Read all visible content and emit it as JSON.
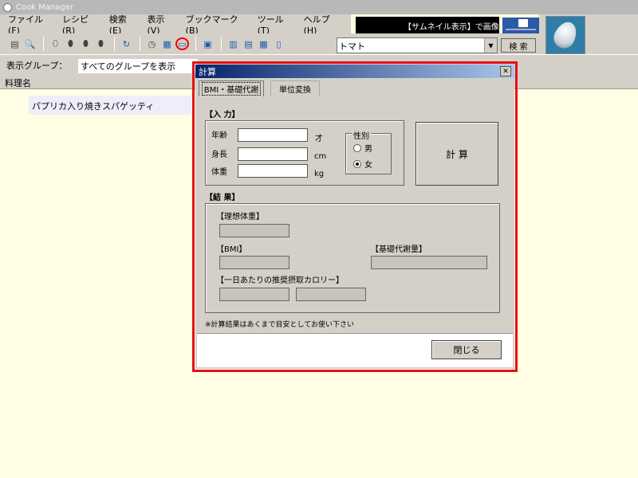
{
  "app": {
    "title": "Cook Manager"
  },
  "menu": [
    "ファイル(F)",
    "レシピ(R)",
    "検索(E)",
    "表示(V)",
    "ブックマーク(B)",
    "ツール(T)",
    "ヘルプ(H)"
  ],
  "caption_banner": "【サムネイル表示】で画像",
  "toolbar": {
    "search_value": "トマト",
    "search_button": "検 索"
  },
  "group_bar": {
    "label": "表示グループ：",
    "value": "すべてのグループを表示"
  },
  "list": {
    "header": "料理名",
    "rows": [
      "パプリカ入り焼きスパゲッティ"
    ]
  },
  "dialog": {
    "title": "計算",
    "close_glyph": "✕",
    "tabs": [
      "BMI・基礎代謝",
      "単位変換"
    ],
    "input_section": "【入 力】",
    "fields": {
      "age_label": "年齢",
      "age_unit": "才",
      "height_label": "身長",
      "height_unit": "cm",
      "weight_label": "体重",
      "weight_unit": "kg"
    },
    "sex": {
      "label": "性別",
      "options": [
        "男",
        "女"
      ],
      "selected": "女"
    },
    "calc_button": "計 算",
    "result_section": "【結 果】",
    "results": {
      "ideal_weight": "【理想体重】",
      "bmi": "【BMI】",
      "basal_metabolism": "【基礎代謝量】",
      "daily_calorie": "【一日あたりの推奨摂取カロリー】"
    },
    "note": "※計算結果はあくまで目安としてお使い下さい",
    "close_button": "閉じる"
  }
}
